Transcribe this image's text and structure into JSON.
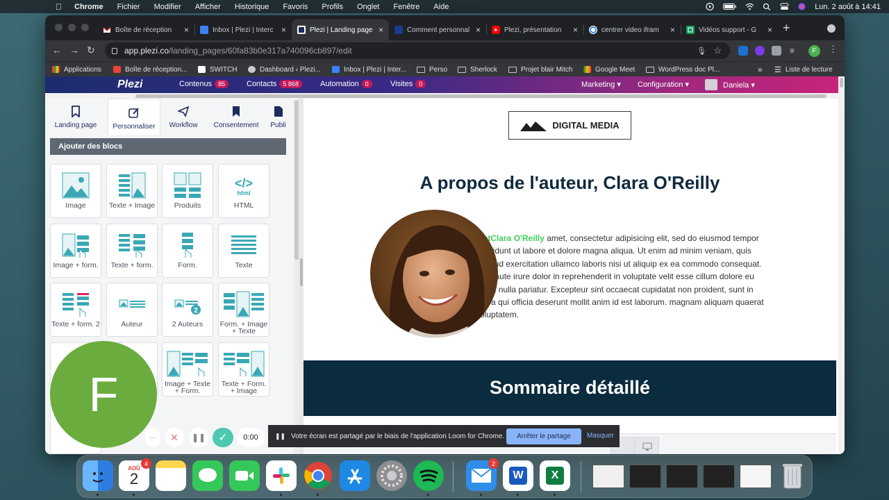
{
  "menubar": {
    "items": [
      "Chrome",
      "Fichier",
      "Modifier",
      "Afficher",
      "Historique",
      "Favoris",
      "Profils",
      "Onglet",
      "Fenêtre",
      "Aide"
    ],
    "clock": "Lun. 2 août à 14:41"
  },
  "browser": {
    "tabs": [
      {
        "title": "Boîte de réception",
        "favicon": "gmail-icon",
        "color": "#ea4335"
      },
      {
        "title": "Inbox | Plezi | Interc",
        "favicon": "intercom-icon",
        "color": "#3b82f6"
      },
      {
        "title": "Plezi | Landing page",
        "favicon": "plezi-icon",
        "color": "#ffffff",
        "active": true
      },
      {
        "title": "Comment personnal",
        "favicon": "doc-icon",
        "color": "#1e3a8a"
      },
      {
        "title": "Plezi, présentation",
        "favicon": "youtube-icon",
        "color": "#ff0000"
      },
      {
        "title": "centrer video ifram",
        "favicon": "google-icon",
        "color": "#4285f4"
      },
      {
        "title": "Vidéos support - G",
        "favicon": "sheets-icon",
        "color": "#0f9d58"
      }
    ],
    "url_host": "app.plezi.co",
    "url_path": "/landing_pages/60fa83b0e317a740096cb897/edit",
    "profile_initial": "F",
    "bookmarks": [
      {
        "label": "Applications",
        "icon": "apps-icon"
      },
      {
        "label": "Boîte de réception...",
        "icon": "gmail-icon"
      },
      {
        "label": "SWITCH",
        "icon": "switch-icon"
      },
      {
        "label": "Dashboard ‹ Plezi...",
        "icon": "wordpress-icon"
      },
      {
        "label": "Inbox | Plezi | Inter...",
        "icon": "intercom-icon"
      },
      {
        "label": "Perso",
        "icon": "folder-icon"
      },
      {
        "label": "Sherlock",
        "icon": "folder-icon"
      },
      {
        "label": "Projet blair Mitch",
        "icon": "folder-icon"
      },
      {
        "label": "Google Meet",
        "icon": "meet-icon"
      },
      {
        "label": "WordPress doc Pl...",
        "icon": "folder-icon"
      }
    ],
    "more_bookmarks": "»",
    "reading_list": "Liste de lecture"
  },
  "plezi": {
    "logo": "Plezi",
    "nav": [
      {
        "label": "Contenus",
        "badge": "85"
      },
      {
        "label": "Contacts",
        "badge": "5 868"
      },
      {
        "label": "Automation",
        "badge": "0"
      },
      {
        "label": "Visites",
        "badge": "0"
      }
    ],
    "right_nav": [
      "Marketing ▾",
      "Configuration ▾"
    ],
    "user": "Daniela ▾"
  },
  "editor": {
    "tabs": [
      {
        "label": "Landing page",
        "icon": "bookmark-icon"
      },
      {
        "label": "Personnaliser",
        "icon": "edit-icon",
        "active": true
      },
      {
        "label": "Workflow",
        "icon": "send-icon"
      },
      {
        "label": "Consentement",
        "icon": "bookmark-filled-icon"
      },
      {
        "label": "Publi",
        "icon": "file-icon"
      }
    ],
    "section_title": "Ajouter des blocs",
    "blocks": [
      {
        "label": "Image",
        "icon": "image-block-icon"
      },
      {
        "label": "Texte + Image",
        "icon": "text-image-block-icon"
      },
      {
        "label": "Produits",
        "icon": "products-block-icon"
      },
      {
        "label": "HTML",
        "icon": "html-block-icon"
      },
      {
        "label": "Image + form.",
        "icon": "image-form-block-icon"
      },
      {
        "label": "Texte + form.",
        "icon": "text-form-block-icon"
      },
      {
        "label": "Form.",
        "icon": "form-block-icon"
      },
      {
        "label": "Texte",
        "icon": "text-block-icon"
      },
      {
        "label": "Texte + form. 2",
        "icon": "text-form-2-block-icon"
      },
      {
        "label": "Auteur",
        "icon": "author-block-icon"
      },
      {
        "label": "2 Auteurs",
        "icon": "two-authors-block-icon"
      },
      {
        "label": "Form. + Image + Texte",
        "icon": "form-image-text-block-icon"
      },
      {
        "label": "Image + Texte + Form.",
        "icon": "image-text-form-block-icon"
      },
      {
        "label": "Texte + Form. + Image",
        "icon": "text-form-image-block-icon"
      }
    ],
    "html_tag": "</>",
    "html_sub": "html",
    "two_count": "2"
  },
  "preview": {
    "brand_logo": "DIGITAL MEDIA",
    "heading": "A propos de l'auteur, Clara O'Reilly",
    "bio_name": "testClara O'Reilly",
    "bio_text": " amet, consectetur adipisicing elit, sed do eiusmod tempor incididunt ut labore et dolore magna aliqua. Ut enim ad minim veniam, quis nostrud exercitation ullamco laboris nisi ut aliquip ex ea commodo consequat. Duis aute irure dolor in reprehenderit in voluptate velit esse cillum dolore eu fugiat nulla pariatur. Excepteur sint occaecat cupidatat non proident, sunt in culpa qui officia deserunt mollit anim id est laborum. magnam aliquam quaerat voluptatem.",
    "section2": "Sommaire détaillé"
  },
  "loom": {
    "message": "Votre écran est partagé par le biais de l'application Loom for Chrome.",
    "stop": "Arrêter le partage",
    "hide": "Masquer",
    "avatar_initial": "F",
    "timer": "0:00",
    "more": "···"
  },
  "dock": {
    "calendar_month": "AOÛ",
    "calendar_day": "2",
    "calendar_badge": "4",
    "mail_badge": "2",
    "word_letter": "W",
    "excel_letter": "X"
  }
}
